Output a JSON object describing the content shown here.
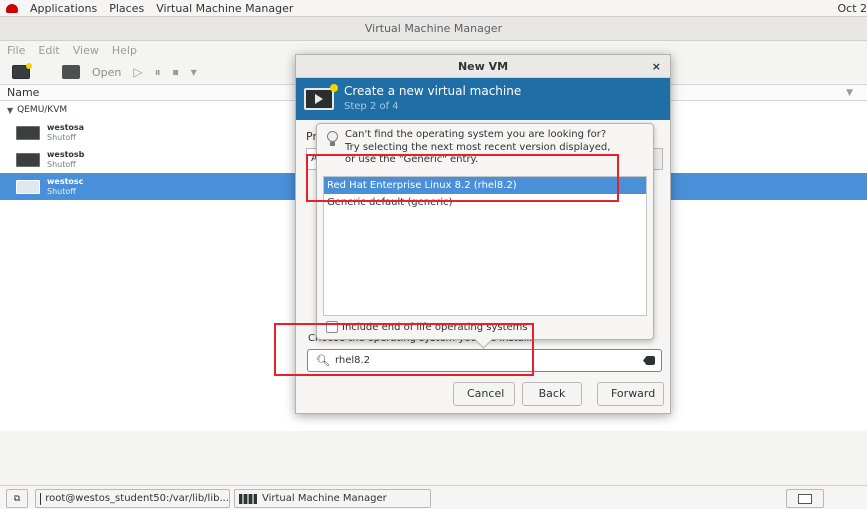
{
  "panel": {
    "applications": "Applications",
    "places": "Places",
    "active_app": "Virtual Machine Manager",
    "clock": "Oct 2"
  },
  "main_window": {
    "title": "Virtual Machine Manager",
    "menu": [
      "File",
      "Edit",
      "View",
      "Help"
    ],
    "toolbar": {
      "open": "Open"
    },
    "list_header": "Name",
    "group": "QEMU/KVM",
    "vms": [
      {
        "name": "westosa",
        "status": "Shutoff",
        "selected": false
      },
      {
        "name": "westosb",
        "status": "Shutoff",
        "selected": false
      },
      {
        "name": "westosc",
        "status": "Shutoff",
        "selected": true
      }
    ]
  },
  "dialog": {
    "title": "New VM",
    "close": "×",
    "banner_title": "Create a new virtual machine",
    "banner_step": "Step 2 of 4",
    "label_prefix": "Pr",
    "combo_stub": "A",
    "choose_label": "Choose the operating system you are installing",
    "search": {
      "icon": "search-icon",
      "value": "rhel8.2"
    },
    "buttons": {
      "cancel": "Cancel",
      "back": "Back",
      "forward": "Forward"
    }
  },
  "popover": {
    "hint_line1": "Can't find the operating system you are looking for?",
    "hint_line2": "Try selecting the next most recent version displayed,",
    "hint_line3": "or use the \"Generic\" entry.",
    "os_options": [
      {
        "label": "Red Hat Enterprise Linux 8.2 (rhel8.2)",
        "selected": true
      },
      {
        "label": "Generic default (generic)",
        "selected": false
      }
    ],
    "eol_checkbox": "Include end of life operating systems"
  },
  "taskbar": {
    "terminal": "root@westos_student50:/var/lib/lib...",
    "vmm": "Virtual Machine Manager"
  },
  "colors": {
    "accent": "#4a90d9",
    "banner": "#1f6ea6",
    "annotation": "#e8202a"
  }
}
